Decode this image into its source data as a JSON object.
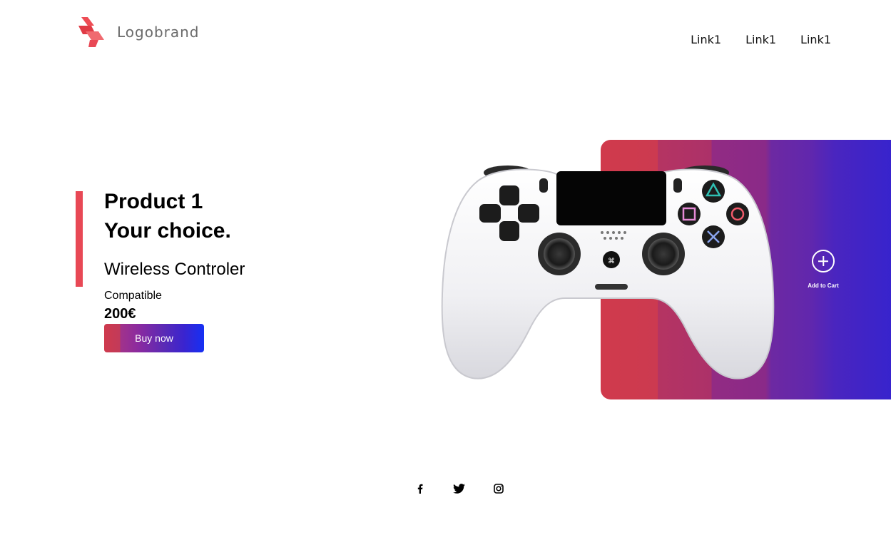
{
  "brand": {
    "name": "Logobrand",
    "logo_icon": "bolt-logo-icon",
    "accent_color": "#e84855"
  },
  "nav": {
    "links": [
      "Link1",
      "Link1",
      "Link1"
    ]
  },
  "hero": {
    "title_line1": "Product 1",
    "title_line2": "Your choice.",
    "subtitle": "Wireless Controler",
    "compat": "Compatible",
    "price": "200€",
    "buy_label": "Buy now"
  },
  "panel": {
    "add_to_cart_label": "Add to Cart",
    "add_icon": "plus-circle-icon",
    "gradient_start": "#d03a4c",
    "gradient_end": "#3523cf"
  },
  "social": {
    "icons": [
      "facebook-icon",
      "twitter-icon",
      "instagram-icon"
    ]
  }
}
